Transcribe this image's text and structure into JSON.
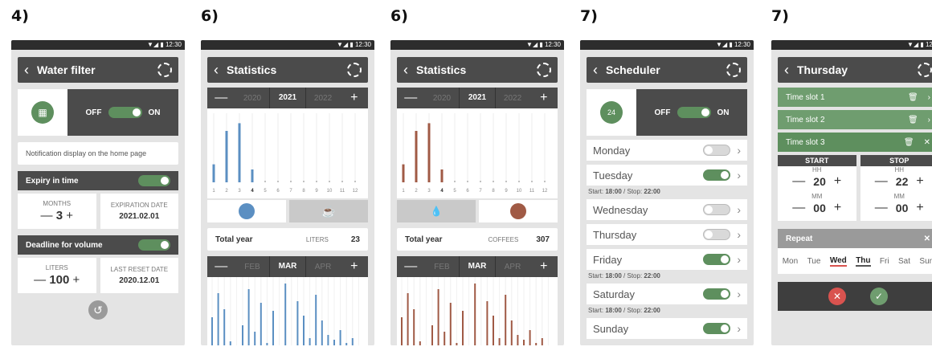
{
  "status_time": "12:30",
  "screens": {
    "water": {
      "step": "4)",
      "title": "Water filter",
      "off": "OFF",
      "on": "ON",
      "notification": "Notification display on the home page",
      "expiry_label": "Expiry in time",
      "months_label": "MONTHS",
      "months_value": "3",
      "exp_date_label": "EXPIRATION DATE",
      "exp_date_value": "2021.02.01",
      "deadline_label": "Deadline for volume",
      "liters_label": "LITERS",
      "liters_value": "100",
      "reset_label": "LAST RESET DATE",
      "reset_value": "2020.12.01",
      "minus": "—",
      "plus": "+"
    },
    "stats_water": {
      "step": "6)",
      "title": "Statistics",
      "years": [
        "2020",
        "2021",
        "2022"
      ],
      "total_label": "Total year",
      "unit": "LITERS",
      "total": "23",
      "months": [
        "FEB",
        "MAR",
        "APR"
      ],
      "x_ticks": [
        "1",
        "2",
        "3",
        "4",
        "5",
        "6",
        "7",
        "8",
        "9",
        "10",
        "11",
        "12"
      ],
      "color": "#5b8fc2",
      "chart_data": {
        "type": "bar",
        "categories": [
          "1",
          "2",
          "3",
          "4",
          "5",
          "6",
          "7",
          "8",
          "9",
          "10",
          "11",
          "12"
        ],
        "values": [
          7,
          20,
          23,
          5,
          0,
          0,
          0,
          0,
          0,
          0,
          0,
          0
        ]
      }
    },
    "stats_coffee": {
      "step": "6)",
      "title": "Statistics",
      "years": [
        "2020",
        "2021",
        "2022"
      ],
      "total_label": "Total year",
      "unit": "COFFEES",
      "total": "307",
      "months": [
        "FEB",
        "MAR",
        "APR"
      ],
      "x_ticks": [
        "1",
        "2",
        "3",
        "4",
        "5",
        "6",
        "7",
        "8",
        "9",
        "10",
        "11",
        "12"
      ],
      "color": "#a05a45",
      "chart_data": {
        "type": "bar",
        "categories": [
          "1",
          "2",
          "3",
          "4",
          "5",
          "6",
          "7",
          "8",
          "9",
          "10",
          "11",
          "12"
        ],
        "values": [
          7,
          20,
          23,
          5,
          0,
          0,
          0,
          0,
          0,
          0,
          0,
          0
        ]
      }
    },
    "scheduler": {
      "step": "7)",
      "title": "Scheduler",
      "off": "OFF",
      "on": "ON",
      "icon_text": "24",
      "days": [
        {
          "name": "Monday",
          "on": false,
          "sub": ""
        },
        {
          "name": "Tuesday",
          "on": true,
          "sub_start": "Start: ",
          "t1": "18:00",
          "sub_mid": " / Stop: ",
          "t2": "22:00"
        },
        {
          "name": "Wednesday",
          "on": false
        },
        {
          "name": "Thursday",
          "on": false
        },
        {
          "name": "Friday",
          "on": true,
          "sub_start": "Start: ",
          "t1": "18:00",
          "sub_mid": " / Stop: ",
          "t2": "22:00"
        },
        {
          "name": "Saturday",
          "on": true,
          "sub_start": "Start: ",
          "t1": "18:00",
          "sub_mid": " / Stop: ",
          "t2": "22:00"
        },
        {
          "name": "Sunday",
          "on": true
        }
      ]
    },
    "thursday": {
      "step": "7)",
      "title": "Thursday",
      "slots": [
        "Time slot 1",
        "Time slot 2",
        "Time slot 3"
      ],
      "start": "START",
      "stop": "STOP",
      "hh": "HH",
      "mm": "MM",
      "start_hh": "20",
      "start_mm": "00",
      "stop_hh": "22",
      "stop_mm": "00",
      "repeat": "Repeat",
      "weekdays": [
        "Mon",
        "Tue",
        "Wed",
        "Thu",
        "Fri",
        "Sat",
        "Sun"
      ]
    }
  }
}
